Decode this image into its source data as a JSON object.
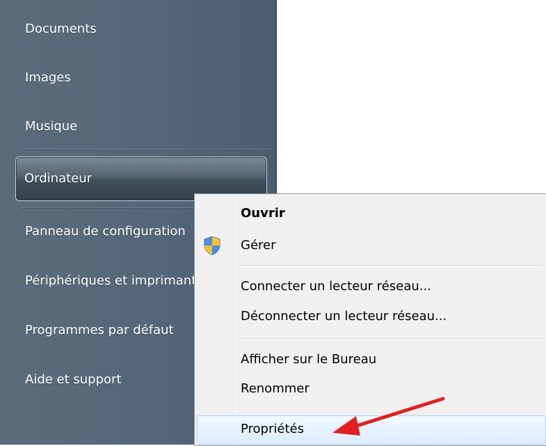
{
  "start_menu": {
    "items": [
      {
        "label": "Documents"
      },
      {
        "label": "Images"
      },
      {
        "label": "Musique"
      },
      {
        "label": "Ordinateur"
      },
      {
        "label": "Panneau de configuration"
      },
      {
        "label": "Périphériques et imprimantes"
      },
      {
        "label": "Programmes par défaut"
      },
      {
        "label": "Aide et support"
      }
    ]
  },
  "context_menu": {
    "items": [
      {
        "label": "Ouvrir",
        "bold": true
      },
      {
        "label": "Gérer",
        "icon": "uac-shield-icon"
      },
      {
        "label": "Connecter un lecteur réseau..."
      },
      {
        "label": "Déconnecter un lecteur réseau..."
      },
      {
        "label": "Afficher sur le Bureau"
      },
      {
        "label": "Renommer"
      },
      {
        "label": "Propriétés",
        "highlighted": true
      }
    ]
  },
  "annotation": {
    "arrow_color": "#e02020",
    "points_to": "Propriétés"
  }
}
